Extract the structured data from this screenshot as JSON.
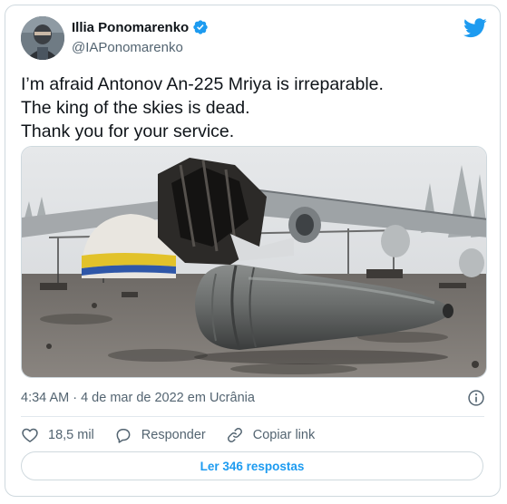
{
  "author": {
    "name": "Illia Ponomarenko",
    "handle": "@IAPonomarenko",
    "verified": true
  },
  "tweet": {
    "lines": [
      "I’m afraid Antonov An-225 Mriya is irreparable.",
      "The king of the skies is dead.",
      "Thank you for your service."
    ],
    "timestamp": "4:34 AM · 4 de mar de 2022 em Ucrânia"
  },
  "actions": {
    "like_count": "18,5 mil",
    "reply_label": "Responder",
    "copy_link_label": "Copiar link"
  },
  "replies_button": "Ler 346 respostas",
  "colors": {
    "accent": "#1d9bf0",
    "text": "#0f1419",
    "muted": "#536471",
    "border": "#cfd9de"
  },
  "icons": [
    "verified-badge-icon",
    "twitter-bird-icon",
    "info-icon",
    "heart-icon",
    "reply-bubble-icon",
    "link-icon"
  ]
}
